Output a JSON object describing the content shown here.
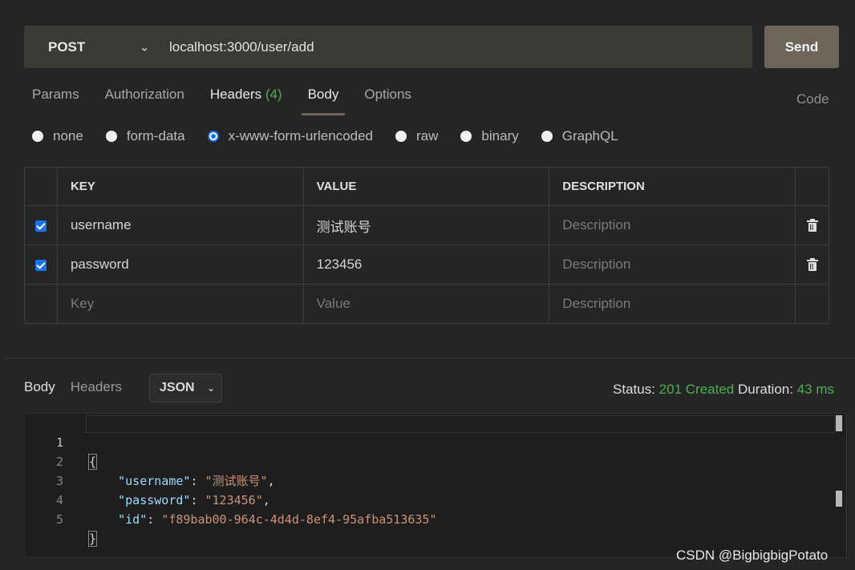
{
  "request": {
    "method": "POST",
    "url": "localhost:3000/user/add",
    "send_label": "Send"
  },
  "tabs": {
    "params": "Params",
    "authorization": "Authorization",
    "headers": "Headers",
    "headers_count": "(4)",
    "body": "Body",
    "options": "Options",
    "code": "Code"
  },
  "body_types": {
    "none": "none",
    "form_data": "form-data",
    "urlencoded": "x-www-form-urlencoded",
    "raw": "raw",
    "binary": "binary",
    "graphql": "GraphQL"
  },
  "table": {
    "headers": {
      "key": "KEY",
      "value": "VALUE",
      "description": "DESCRIPTION"
    },
    "rows": [
      {
        "key": "username",
        "value": "测试账号",
        "description_placeholder": "Description"
      },
      {
        "key": "password",
        "value": "123456",
        "description_placeholder": "Description"
      }
    ],
    "new_row": {
      "key_placeholder": "Key",
      "value_placeholder": "Value",
      "description_placeholder": "Description"
    }
  },
  "response": {
    "tabs": {
      "body": "Body",
      "headers": "Headers"
    },
    "format": "JSON",
    "status_label": "Status:",
    "status_value": "201 Created",
    "duration_label": "Duration:",
    "duration_value": "43 ms",
    "code": {
      "line_numbers": [
        "1",
        "2",
        "3",
        "4",
        "5"
      ],
      "open_brace": "{",
      "close_brace": "}",
      "k1": "\"username\"",
      "v1": "\"测试账号\"",
      "k2": "\"password\"",
      "v2": "\"123456\"",
      "k3": "\"id\"",
      "v3": "\"f89bab00-964c-4d4d-8ef4-95afba513635\""
    }
  },
  "watermark": "CSDN @BigbigbigPotato",
  "colors": {
    "accent_green": "#4caf50",
    "send_button": "#6b655a",
    "checkbox_blue": "#1a73e8"
  }
}
